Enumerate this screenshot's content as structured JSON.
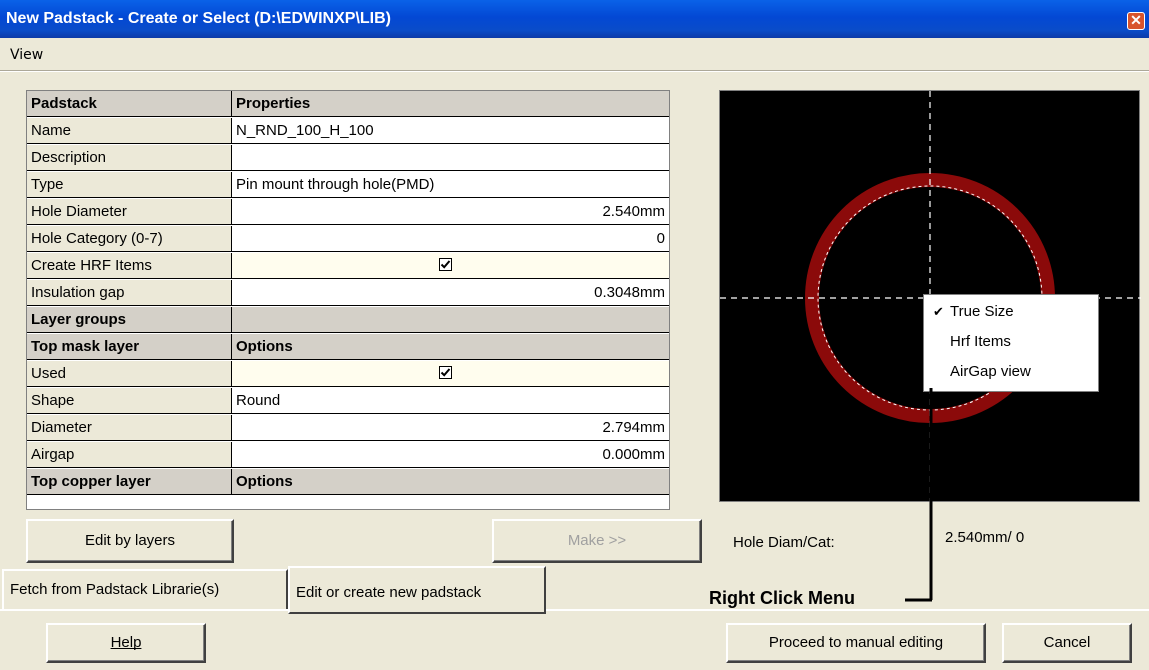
{
  "window": {
    "title": "New Padstack - Create or Select (D:\\EDWINXP\\LIB)",
    "close_glyph": "✕"
  },
  "menu": {
    "items": [
      "View"
    ]
  },
  "grid": {
    "rows": [
      {
        "kind": "header",
        "label": "Padstack",
        "value": "Properties"
      },
      {
        "kind": "normal",
        "label": "Name",
        "value": "N_RND_100_H_100"
      },
      {
        "kind": "normal",
        "label": "Description",
        "value": ""
      },
      {
        "kind": "normal",
        "label": "Type",
        "value": "Pin mount through hole(PMD)"
      },
      {
        "kind": "normal",
        "label": "Hole Diameter",
        "value": "2.540mm",
        "align": "right"
      },
      {
        "kind": "normal",
        "label": "Hole Category (0-7)",
        "value": "0",
        "align": "right"
      },
      {
        "kind": "check",
        "label": "Create HRF Items",
        "checked": true
      },
      {
        "kind": "normal",
        "label": "Insulation gap",
        "value": "0.3048mm",
        "align": "right"
      },
      {
        "kind": "header",
        "label": "Layer groups",
        "value": ""
      },
      {
        "kind": "header",
        "label": "Top mask layer",
        "value": "Options"
      },
      {
        "kind": "check",
        "label": "Used",
        "checked": true
      },
      {
        "kind": "normal",
        "label": "Shape",
        "value": "Round"
      },
      {
        "kind": "normal",
        "label": "Diameter",
        "value": "2.794mm",
        "align": "right"
      },
      {
        "kind": "normal",
        "label": "Airgap",
        "value": "0.000mm",
        "align": "right"
      },
      {
        "kind": "header",
        "label": "Top copper layer",
        "value": "Options"
      }
    ]
  },
  "preview": {
    "ring_color": "#8b0a0a",
    "crosshair_color": "#ffffff",
    "context_menu": {
      "items": [
        {
          "label": "True Size",
          "checked": true
        },
        {
          "label": "Hrf Items",
          "checked": false
        },
        {
          "label": "AirGap view",
          "checked": false
        }
      ]
    }
  },
  "buttons": {
    "edit_by_layers": "Edit by layers",
    "make": "Make >>",
    "help": "Help",
    "proceed": "Proceed to manual editing",
    "cancel": "Cancel"
  },
  "hole_info": {
    "label": "Hole Diam/Cat:",
    "value": "2.540mm/ 0"
  },
  "tabs": [
    {
      "label": "Fetch from Padstack Librarie(s)",
      "active": false
    },
    {
      "label": "Edit or create new padstack",
      "active": true
    }
  ],
  "annotation": {
    "label": "Right Click Menu"
  }
}
